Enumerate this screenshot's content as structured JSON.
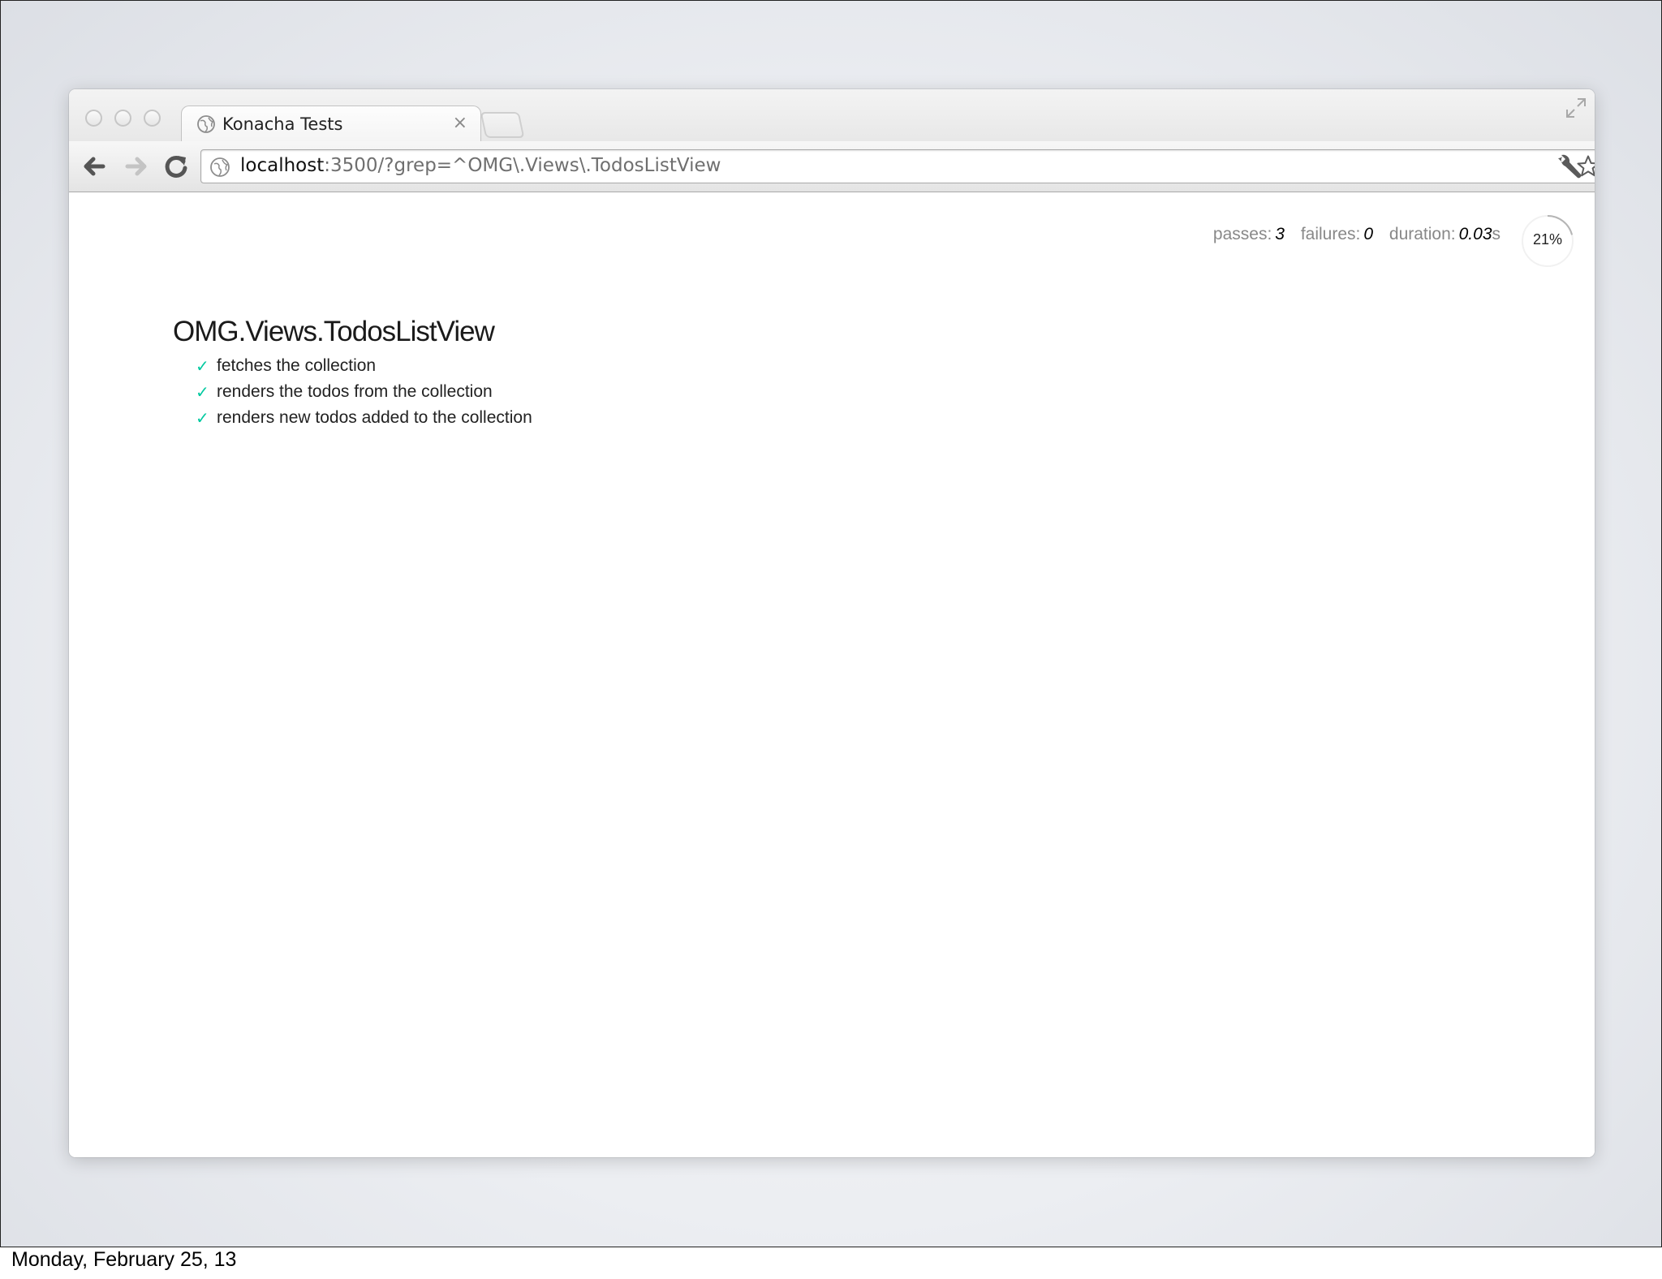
{
  "browser": {
    "tab": {
      "title": "Konacha Tests",
      "close_glyph": "×"
    },
    "address_bar": {
      "host": "localhost",
      "path": ":3500/?grep=^OMG\\.Views\\.TodosListView"
    },
    "icons": {
      "traffic_lights": [
        "close-light",
        "minimize-light",
        "zoom-light"
      ],
      "nav": [
        "back-arrow-icon",
        "forward-arrow-icon",
        "reload-icon"
      ],
      "omnibox": [
        "globe-icon",
        "star-icon"
      ],
      "toolbar": [
        "wrench-icon"
      ]
    }
  },
  "report": {
    "stats": {
      "passes_label": "passes:",
      "passes": "3",
      "failures_label": "failures:",
      "failures": "0",
      "duration_label": "duration:",
      "duration": "0.03",
      "duration_unit": "s"
    },
    "progress": {
      "label": "21%",
      "value": 0.21
    },
    "suite": {
      "title": "OMG.Views.TodosListView",
      "tests": [
        {
          "title": "fetches the collection",
          "status": "pass",
          "mark": "✓"
        },
        {
          "title": "renders the todos from the collection",
          "status": "pass",
          "mark": "✓"
        },
        {
          "title": "renders new todos added to the collection",
          "status": "pass",
          "mark": "✓"
        }
      ]
    },
    "colors": {
      "pass": "#00c9a0",
      "stat_label": "#888888"
    }
  },
  "slide_footer": {
    "date": "Monday, February 25, 13"
  }
}
